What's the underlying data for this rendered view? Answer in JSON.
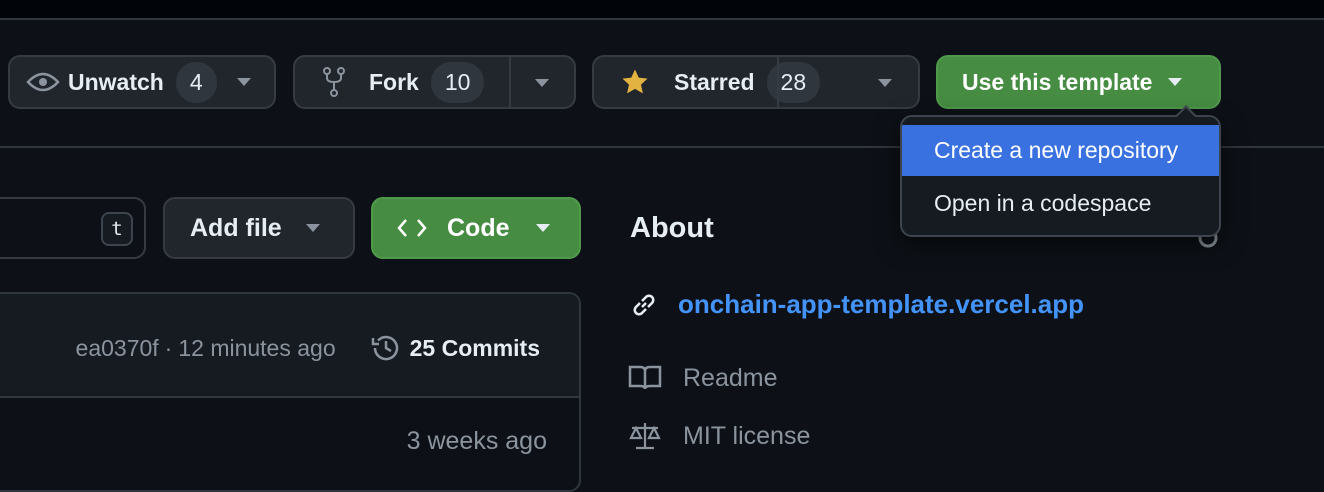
{
  "actions": {
    "watch": {
      "label": "Unwatch",
      "count": "4"
    },
    "fork": {
      "label": "Fork",
      "count": "10"
    },
    "star": {
      "label": "Starred",
      "count": "28"
    },
    "template": {
      "label": "Use this template"
    }
  },
  "template_menu": {
    "items": [
      {
        "label": "Create a new repository",
        "active": true
      },
      {
        "label": "Open in a codespace"
      }
    ]
  },
  "file_bar": {
    "shortcut": "t",
    "add_file": "Add file",
    "code": "Code"
  },
  "commit_box": {
    "sha": "ea0370f",
    "separator": "·",
    "time": "12 minutes ago",
    "commits": "25 Commits",
    "row_time": "3 weeks ago"
  },
  "about": {
    "title": "About",
    "link": "onchain-app-template.vercel.app",
    "readme": "Readme",
    "license": "MIT license"
  },
  "colors": {
    "green": "#468c42",
    "accent": "#4493f8",
    "highlight": "#3a71e0",
    "star": "#e3b341"
  }
}
